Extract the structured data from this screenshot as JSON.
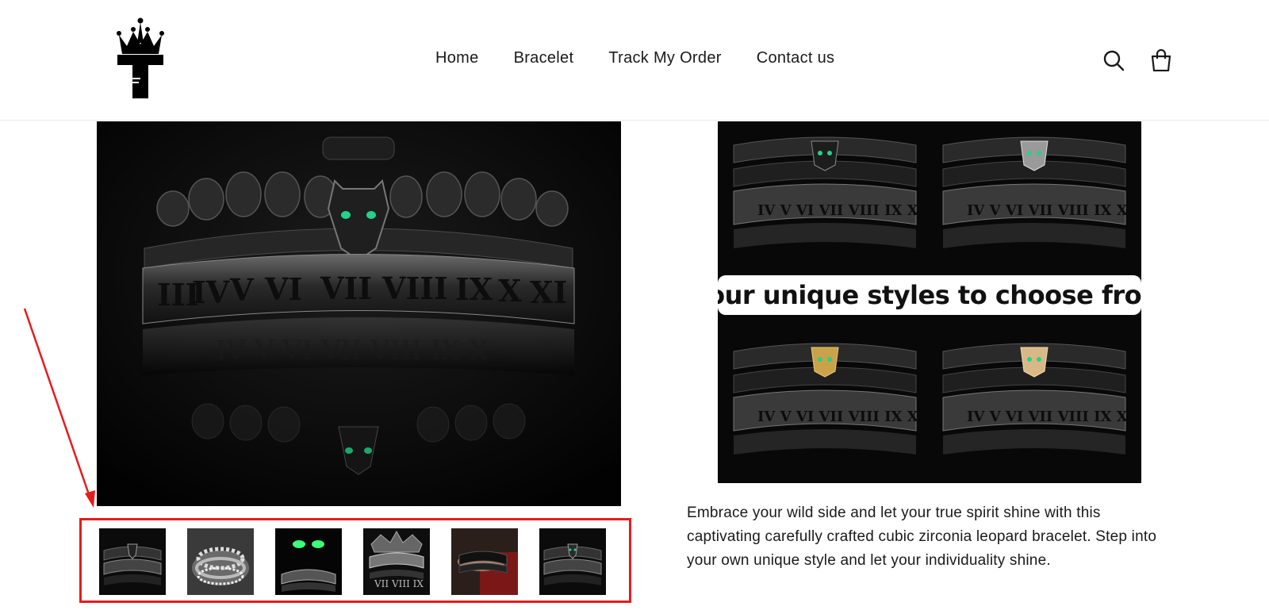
{
  "header": {
    "logo_icon": "crown-t-logo",
    "nav": [
      {
        "label": "Home"
      },
      {
        "label": "Bracelet"
      },
      {
        "label": "Track My Order"
      },
      {
        "label": "Contact us"
      }
    ],
    "search_icon": "search-icon",
    "cart_icon": "cart-icon"
  },
  "product": {
    "main_image": "black leopard bracelet set with roman numeral cuff",
    "styles_image": {
      "banner_text": "Four unique styles to choose from"
    },
    "thumbnails_count": 6,
    "description": "Embrace your wild side and let your true spirit shine with this captivating carefully crafted cubic zirconia leopard bracelet. Step into your own unique style and let your individuality shine."
  },
  "annotation": {
    "highlight_color": "#e51c1c",
    "arrow_color": "#e51c1c"
  },
  "colors": {
    "accent_green": "#22d38a",
    "gold": "#c9a24a"
  }
}
